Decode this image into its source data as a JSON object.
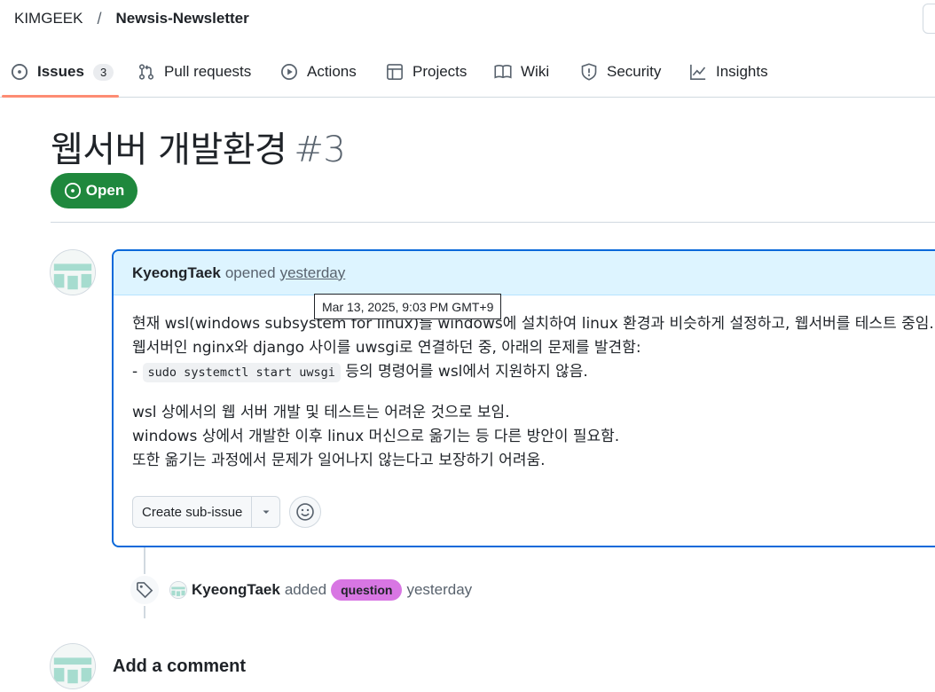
{
  "breadcrumb": {
    "owner": "KIMGEEK",
    "separator": "/",
    "repo": "Newsis-Newsletter"
  },
  "tabs": [
    {
      "label": "Issues",
      "icon": "issue-opened-icon",
      "count": "3",
      "active": true
    },
    {
      "label": "Pull requests",
      "icon": "git-pull-request-icon"
    },
    {
      "label": "Actions",
      "icon": "play-icon"
    },
    {
      "label": "Projects",
      "icon": "table-icon"
    },
    {
      "label": "Wiki",
      "icon": "book-icon"
    },
    {
      "label": "Security",
      "icon": "shield-icon"
    },
    {
      "label": "Insights",
      "icon": "graph-icon"
    }
  ],
  "issue": {
    "title": "웹서버 개발환경",
    "number": "#3",
    "state": "Open"
  },
  "comment": {
    "author": "KyeongTaek",
    "verb": "opened",
    "when": "yesterday",
    "tooltip": "Mar 13, 2025, 9:03 PM GMT+9",
    "body": {
      "line1": "현재 wsl(windows subsystem for linux)를 windows에 설치하여 linux 환경과 비슷하게 설정하고, 웹서버를 테스트 중임.",
      "line2": "웹서버인 nginx와 django 사이를 uwsgi로 연결하던 중, 아래의 문제를 발견함:",
      "line3_prefix": "- ",
      "line3_code": "sudo systemctl start uwsgi",
      "line3_suffix": " 등의 명령어를 wsl에서 지원하지 않음.",
      "line4": "wsl 상에서의 웹 서버 개발 및 테스트는 어려운 것으로 보임.",
      "line5": "windows 상에서 개발한 이후 linux 머신으로 옮기는 등 다른 방안이 필요함.",
      "line6": "또한 옮기는 과정에서 문제가 일어나지 않는다고 보장하기 어려움."
    },
    "actions": {
      "sub_issue_label": "Create sub-issue"
    }
  },
  "event": {
    "author": "KyeongTaek",
    "verb": "added",
    "label_name": "question",
    "label_color": "#d876e3",
    "when": "yesterday"
  },
  "add_comment": {
    "heading": "Add a comment"
  },
  "colors": {
    "accent": "#0969da",
    "open_green": "#1f883d",
    "tab_underline": "#fd8c73",
    "avatar_teal": "#a6dccf"
  }
}
